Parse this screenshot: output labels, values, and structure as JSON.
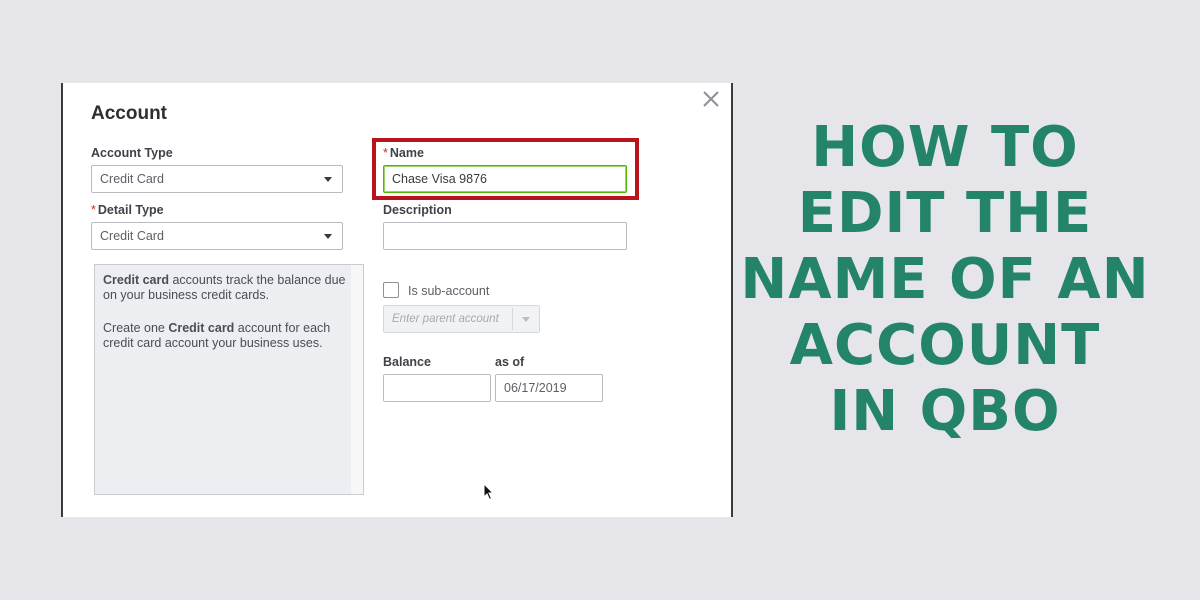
{
  "dialog": {
    "title": "Account",
    "account_type": {
      "label": "Account Type",
      "value": "Credit Card"
    },
    "detail_type": {
      "required_mark": "*",
      "label": "Detail Type",
      "value": "Credit Card"
    },
    "name": {
      "required_mark": "*",
      "label": "Name",
      "value": "Chase Visa 9876"
    },
    "description": {
      "label": "Description",
      "value": ""
    },
    "info": {
      "p1_bold": "Credit card",
      "p1_rest": " accounts track the balance due on your business credit cards.",
      "p2_start": "Create one ",
      "p2_bold": "Credit card",
      "p2_rest": " account for each credit card account your business uses."
    },
    "sub_account": {
      "label": "Is sub-account",
      "checked": false,
      "parent_placeholder": "Enter parent account"
    },
    "balance": {
      "label": "Balance",
      "value": ""
    },
    "as_of": {
      "label": "as of",
      "value": "06/17/2019"
    }
  },
  "headline": {
    "lines": [
      "HOW TO",
      "EDIT THE",
      "NAME OF AN",
      "ACCOUNT",
      "IN QBO"
    ],
    "color": "#23846a"
  },
  "colors": {
    "background": "#e6e5ea",
    "highlight": "#b8141c",
    "focus": "#53b700"
  }
}
